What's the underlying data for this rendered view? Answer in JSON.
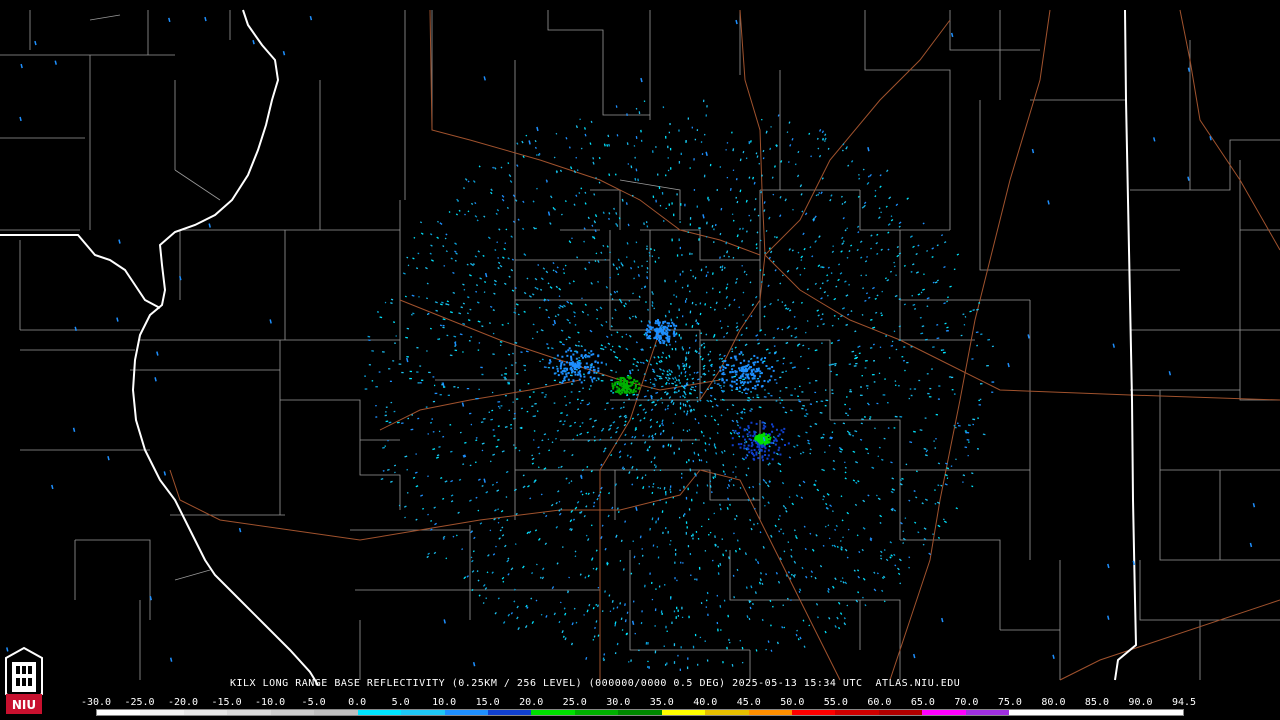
{
  "product": {
    "caption": "KILX LONG RANGE BASE REFLECTIVITY (0.25KM / 256 LEVEL) (000000/0000 0.5 DEG) 2025-05-13 15:34 UTC  ATLAS.NIU.EDU"
  },
  "legend": {
    "labels": [
      "-30.0",
      "-25.0",
      "-20.0",
      "-15.0",
      "-10.0",
      "-5.0",
      "0.0",
      "5.0",
      "10.0",
      "15.0",
      "20.0",
      "25.0",
      "30.0",
      "35.0",
      "40.0",
      "45.0",
      "50.0",
      "55.0",
      "60.0",
      "65.0",
      "70.0",
      "75.0",
      "80.0",
      "85.0",
      "90.0",
      "94.5"
    ],
    "colors": [
      "#ffffff",
      "#f2f2f2",
      "#e6e6e6",
      "#d9d9d9",
      "#cccccc",
      "#bfbfbf",
      "#00e5ff",
      "#1ec8f5",
      "#1e90ff",
      "#1040d0",
      "#00e000",
      "#00b000",
      "#008800",
      "#ffff00",
      "#e6c000",
      "#ff9000",
      "#ff0000",
      "#d00000",
      "#b00000",
      "#ff00ff",
      "#a030e0",
      "#ffffff",
      "#ffffff",
      "#ffffff",
      "#ffffff"
    ]
  },
  "logo": {
    "text": "NIU",
    "accent_color": "#c8102e"
  },
  "map_style": {
    "county_line": "#9a9a9a",
    "state_line": "#ffffff",
    "highway": "#a0522d",
    "background": "#000000"
  }
}
